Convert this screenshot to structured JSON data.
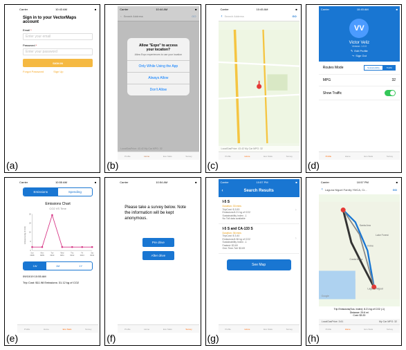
{
  "labels": {
    "a": "(a)",
    "b": "(b)",
    "c": "(c)",
    "d": "(d)",
    "e": "(e)",
    "f": "(f)",
    "g": "(g)",
    "h": "(h)"
  },
  "status": {
    "carrier": "Carrier",
    "wifi": "ᯤ",
    "time_a": "10:43 AM",
    "time_b": "10:44 AM",
    "time_c": "10:45 AM",
    "time_d": "10:45 AM",
    "time_e": "10:55 AM",
    "time_f": "10:54 AM",
    "time_g": "10:57 PM",
    "time_h": "10:57 PM",
    "batt": "■"
  },
  "nav": {
    "profile": "Profile",
    "home": "Home",
    "ecostats": "Eco Stats",
    "survey": "Survey"
  },
  "a": {
    "title": "Sign in to your VectorMaps account",
    "email_label": "Email",
    "req": "*",
    "email_ph": "Enter your email",
    "password_label": "Password",
    "password_ph": "Enter your password",
    "signin_btn": "SIGN IN",
    "forgot": "Forgot Password",
    "signup": "Sign Up"
  },
  "b": {
    "search_ph": "Search Address",
    "go": "GO",
    "dlg_title1": "Allow \"Expo\" to access",
    "dlg_title2": "your location?",
    "dlg_sub": "Allow Expo experiences to use your location",
    "opt1": "Only While Using the App",
    "opt2": "Always Allow",
    "opt3": "Don't Allow",
    "footer": "LocalGasPrice: 43.42   My Car MPG: 32"
  },
  "c": {
    "search_ph": "Search Address",
    "go": "GO",
    "footer": "LocalGasPrice: 43.42   My Car MPG: 32"
  },
  "d": {
    "initials": "VV",
    "name": "Victor Veliz",
    "version": "Version: 1.0.0",
    "edit": "Edit Profile",
    "signout": "Sign Out",
    "row1": "Routes Mode",
    "seg1": "Sustainability",
    "seg2": "Traffic",
    "row2": "MPG",
    "mpg_val": "32",
    "row3": "Show Traffic"
  },
  "e": {
    "tab1": "Emissions",
    "tab2": "Spending",
    "title": "Emissions Chart",
    "subtitle": "CO2 VS Time",
    "ylabel": "Emissions (kg of CO2)",
    "r1": "1W",
    "r2": "1M",
    "r3": "1Y",
    "meta1": "09/10/19 10:55 AM",
    "meta2": "Trip Cost: $11.98 Emissions: 31.12 kg of CO2"
  },
  "chart_data": {
    "type": "line",
    "title": "Emissions Chart",
    "subtitle": "CO2 VS Time",
    "ylabel": "Emissions (kg of CO2)",
    "xlabel": "",
    "categories": [
      "Sun 09/08",
      "Mon 09/09",
      "Tue 09/10",
      "Wed 09/11",
      "Thu 09/12",
      "Fri 09/13",
      "Sat 09/14"
    ],
    "values": [
      3,
      3,
      31.12,
      3,
      3,
      3,
      3
    ],
    "ylim": [
      0,
      32
    ]
  },
  "f": {
    "text": "Please take a survey below. Note the information will be kept anonymous.",
    "btn1": "Pre drive",
    "btn2": "After drive"
  },
  "g": {
    "title": "Search Results",
    "r1_name": "I-5 S",
    "r1_dur": "Duration: 33 mins",
    "r1_l2": "TripCost: $ 3.53",
    "r1_l3": "Emissions:8.21 kg of CO2",
    "r1_l4": "Sustainability Index: -1",
    "r1_l5": "No Toll data available",
    "r2_name": "I-5 S and CA-133 S",
    "r2_dur": "Duration: 36 mins",
    "r2_l2": "TripCost: $ 3.40",
    "r2_l3": "Emissions:8.36 kg of CO2",
    "r2_l4": "Sustainability Index: -1",
    "r2_l5": "Fastest: $3.69",
    "r2_l6": "One-Time-Toll: $3.69",
    "btn": "See Map"
  },
  "h": {
    "dest": "Laguna Niguel Family YMCA, Cr...",
    "go": "GO",
    "info1": "Trip Emissions(Sus. Index): 8.21 kg of CO2 (-1)",
    "info2": "Distance: 29.6 mi",
    "info3": "Cost: $3.33",
    "foot_l": "LocalGasPrice: 3.61",
    "foot_r": "My Car MPG: 32"
  }
}
